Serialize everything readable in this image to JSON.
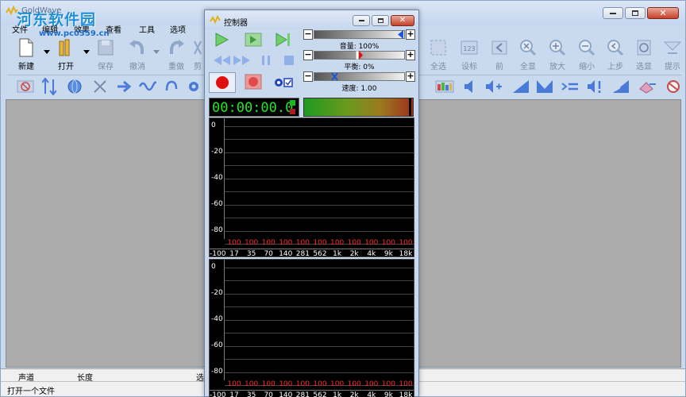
{
  "window": {
    "title": "GoldWave",
    "watermark_logo": "河东软件园",
    "watermark_url": "www.pc0359.cn"
  },
  "menu": [
    "文件",
    "编辑",
    "效果",
    "查看",
    "工具",
    "选项"
  ],
  "toolbar": {
    "new": "新建",
    "open": "打开",
    "save": "保存",
    "undo": "撤消",
    "redo": "重做",
    "cut_partial": "剪",
    "select_all": "全选",
    "set_marker": "设标",
    "prev": "前",
    "show_all": "全显",
    "zoom_in": "放大",
    "zoom_out": "缩小",
    "previous_step": "上步",
    "show_selection": "选显",
    "hint": "提示",
    "set_marker_icon_text": "123"
  },
  "status": {
    "header_channel": "声道",
    "header_length": "长度",
    "header_select_partial": "选",
    "message": "打开一个文件"
  },
  "controller": {
    "title": "控制器",
    "volume_label": "音量: 100%",
    "volume_value": 100,
    "balance_label": "平衡: 0%",
    "balance_value": 0,
    "speed_label": "速度: 1.00",
    "speed_value": 1.0,
    "time_display": "00:00:00.0",
    "minus": "−",
    "plus": "+",
    "spectrum": {
      "y_labels": [
        "0",
        "-20",
        "-40",
        "-60",
        "-80"
      ],
      "y_min_label": "-100",
      "x_labels": [
        "17",
        "35",
        "70",
        "140",
        "281",
        "562",
        "1k",
        "2k",
        "4k",
        "9k",
        "18k"
      ],
      "peak_values": [
        "100",
        "100",
        "100",
        "100",
        "100",
        "100",
        "100",
        "100",
        "100",
        "100",
        "100"
      ]
    }
  },
  "colors": {
    "titlebar": "#c6d7ee",
    "time_text": "#23e623",
    "peak_text": "#ff2b2b",
    "record": "#e01010",
    "play": "#3fbf3f"
  }
}
